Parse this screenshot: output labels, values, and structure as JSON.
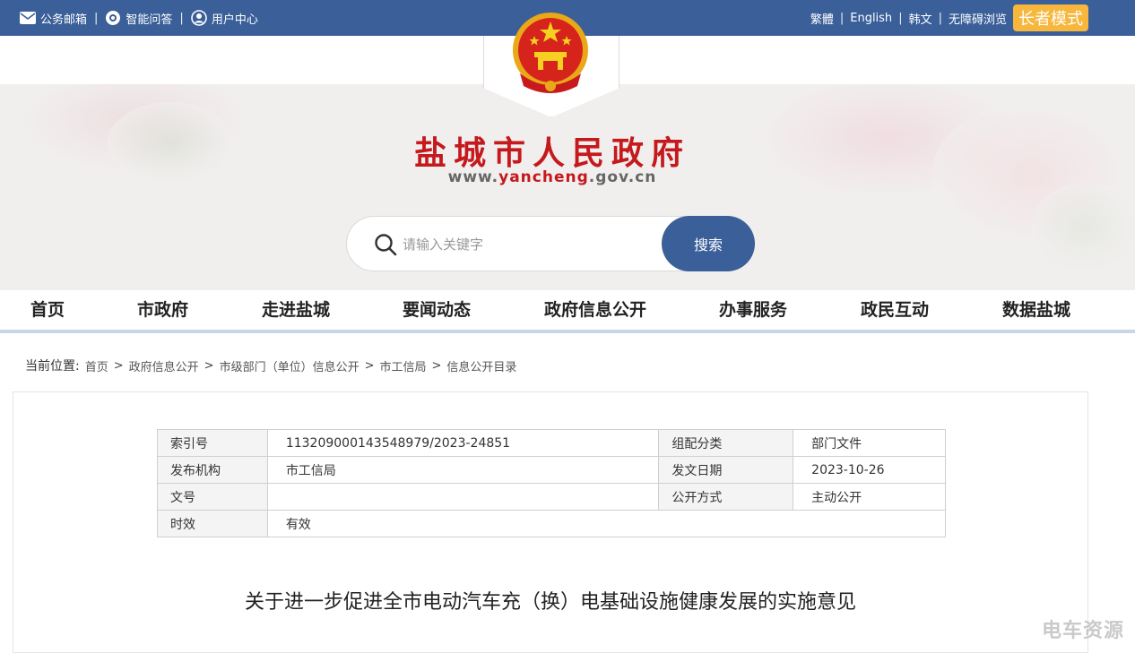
{
  "topbar": {
    "links": [
      {
        "label": "公务邮箱",
        "icon": "mail-icon"
      },
      {
        "label": "智能问答",
        "icon": "chat-bot-icon"
      },
      {
        "label": "用户中心",
        "icon": "user-icon"
      }
    ],
    "lang": [
      "繁體",
      "English",
      "韩文",
      "无障碍浏览"
    ],
    "elder_mode": "长者模式"
  },
  "header": {
    "title": "盐城市人民政府",
    "url_prefix": "www.",
    "url_highlight": "yancheng",
    "url_suffix": ".gov.cn"
  },
  "search": {
    "placeholder": "请输入关键字",
    "button": "搜索"
  },
  "nav": [
    "首页",
    "市政府",
    "走进盐城",
    "要闻动态",
    "政府信息公开",
    "办事服务",
    "政民互动",
    "数据盐城"
  ],
  "breadcrumb": {
    "lead": "当前位置:",
    "items": [
      "首页",
      "政府信息公开",
      "市级部门（单位）信息公开",
      "市工信局",
      "信息公开目录"
    ]
  },
  "meta": {
    "index_label": "索引号",
    "index_value": "113209000143548979/2023-24851",
    "category_label": "组配分类",
    "category_value": "部门文件",
    "issuer_label": "发布机构",
    "issuer_value": "市工信局",
    "date_label": "发文日期",
    "date_value": "2023-10-26",
    "docno_label": "文号",
    "docno_value": "",
    "open_label": "公开方式",
    "open_value": "主动公开",
    "validity_label": "时效",
    "validity_value": "有效"
  },
  "document": {
    "title": "关于进一步促进全市电动汽车充（换）电基础设施健康发展的实施意见"
  },
  "watermark": "电车资源",
  "colors": {
    "topbar": "#3a5f99",
    "title_red": "#c4191d",
    "elder": "#f6b73c"
  }
}
